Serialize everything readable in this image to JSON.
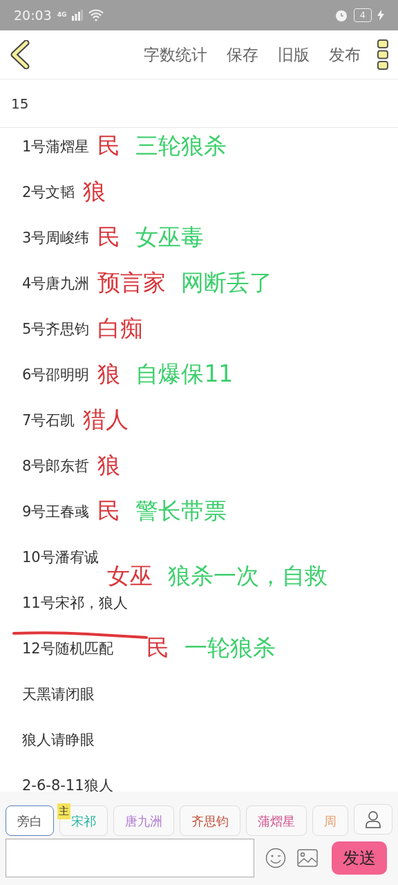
{
  "status_bar": {
    "time": "20:03",
    "network": "4G",
    "battery": "4"
  },
  "toolbar": {
    "actions": [
      "字数统计",
      "保存",
      "旧版",
      "发布"
    ]
  },
  "word_count": "15",
  "lines": [
    {
      "text": "1号蒲熠星",
      "struck": false,
      "notes": [
        {
          "kind": "role",
          "text": "民"
        },
        {
          "kind": "remark",
          "text": "三轮狼杀"
        }
      ]
    },
    {
      "text": "2号文韬",
      "struck": false,
      "notes": [
        {
          "kind": "role",
          "text": "狼"
        }
      ]
    },
    {
      "text": "3号周峻纬",
      "struck": false,
      "notes": [
        {
          "kind": "role",
          "text": "民"
        },
        {
          "kind": "remark",
          "text": "女巫毒"
        }
      ]
    },
    {
      "text": "4号唐九洲",
      "struck": false,
      "notes": [
        {
          "kind": "role",
          "text": "预言家"
        },
        {
          "kind": "remark",
          "text": "网断丢了"
        }
      ]
    },
    {
      "text": "5号齐思钧",
      "struck": false,
      "notes": [
        {
          "kind": "role",
          "text": "白痴"
        }
      ]
    },
    {
      "text": "6号邵明明",
      "struck": false,
      "notes": [
        {
          "kind": "role",
          "text": "狼"
        },
        {
          "kind": "remark",
          "text": "自爆保11"
        }
      ]
    },
    {
      "text": "7号石凯",
      "struck": false,
      "notes": [
        {
          "kind": "role",
          "text": "猎人"
        }
      ]
    },
    {
      "text": "8号郎东哲",
      "struck": false,
      "notes": [
        {
          "kind": "role",
          "text": "狼"
        }
      ]
    },
    {
      "text": "9号王春彧",
      "struck": false,
      "notes": [
        {
          "kind": "role",
          "text": "民"
        },
        {
          "kind": "remark",
          "text": "警长带票"
        }
      ]
    },
    {
      "text": "10号潘宥诚",
      "struck": false,
      "notes": [
        {
          "kind": "role",
          "text": "女巫"
        },
        {
          "kind": "remark",
          "text": "狼杀一次，自救"
        }
      ]
    },
    {
      "text": "11号宋祁，狼人",
      "struck": false
    },
    {
      "text": "12号随机匹配",
      "struck": true,
      "notes": [
        {
          "kind": "role",
          "text": "民"
        },
        {
          "kind": "remark",
          "text": "一轮狼杀"
        }
      ]
    },
    {
      "text": "天黑请闭眼",
      "struck": false
    },
    {
      "text": "狼人请睁眼",
      "struck": false
    },
    {
      "text": "2-6-8-11狼人",
      "struck": false
    }
  ],
  "speakers": [
    {
      "name": "旁白",
      "selected": true,
      "color": "#555555"
    },
    {
      "name": "宋祁",
      "selected": false,
      "color": "#2bb5a0",
      "badge": "主"
    },
    {
      "name": "唐九洲",
      "selected": false,
      "color": "#b07ad0"
    },
    {
      "name": "齐思钧",
      "selected": false,
      "color": "#c0503a"
    },
    {
      "name": "蒲熠星",
      "selected": false,
      "color": "#d0508a"
    },
    {
      "name": "周",
      "selected": false,
      "color": "#e8a070"
    }
  ],
  "send_button": "发送"
}
